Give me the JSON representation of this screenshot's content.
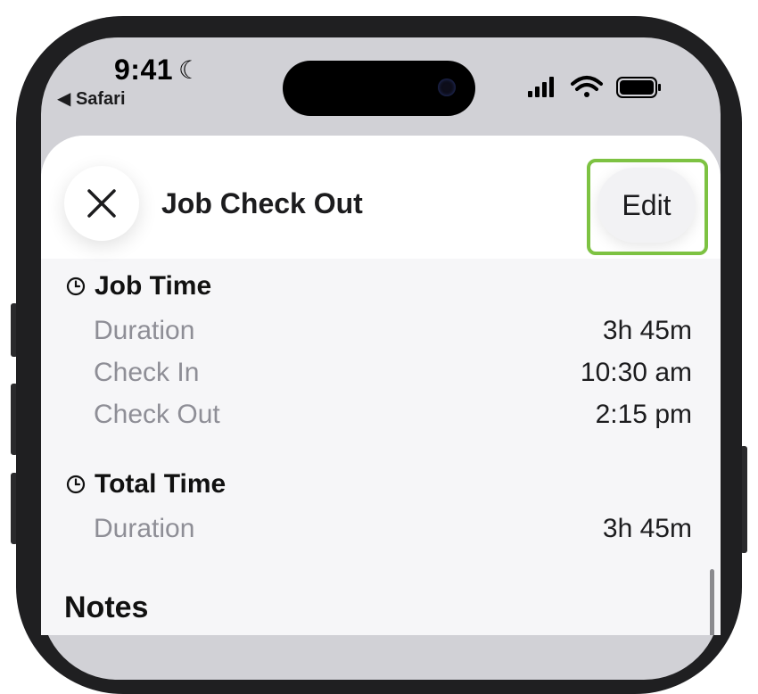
{
  "status_bar": {
    "time": "9:41",
    "back_app": "◀ Safari"
  },
  "header": {
    "title": "Job Check Out",
    "edit_label": "Edit",
    "close_icon": "close-icon",
    "highlight_color": "#7dc242"
  },
  "job_time": {
    "title": "Job Time",
    "rows": [
      {
        "label": "Duration",
        "value": "3h 45m"
      },
      {
        "label": "Check In",
        "value": "10:30 am"
      },
      {
        "label": "Check Out",
        "value": "2:15 pm"
      }
    ]
  },
  "total_time": {
    "title": "Total Time",
    "rows": [
      {
        "label": "Duration",
        "value": "3h 45m"
      }
    ]
  },
  "notes": {
    "title": "Notes"
  }
}
